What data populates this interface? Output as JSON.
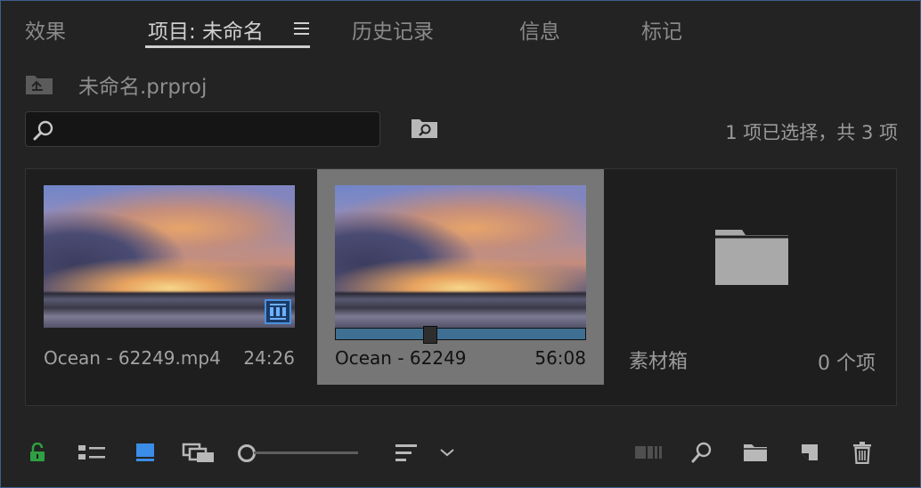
{
  "tabs": [
    {
      "label": "效果",
      "active": false
    },
    {
      "label": "项目: 未命名",
      "active": true
    },
    {
      "label": "历史记录",
      "active": false
    },
    {
      "label": "信息",
      "active": false
    },
    {
      "label": "标记",
      "active": false
    }
  ],
  "project": {
    "name": "未命名.prproj"
  },
  "search": {
    "placeholder": "",
    "value": ""
  },
  "selection_info": "1 项已选择，共 3 项",
  "items": [
    {
      "name": "Ocean - 62249.mp4",
      "duration": "24:26",
      "type": "clip",
      "selected": false,
      "badge": "film-icon"
    },
    {
      "name": "Ocean - 62249",
      "duration": "56:08",
      "type": "sequence",
      "selected": true,
      "scrub_position": 0.37
    },
    {
      "name": "素材箱",
      "count": "0 个项",
      "type": "bin",
      "selected": false
    }
  ],
  "colors": {
    "background": "#232323",
    "selected_tile": "#767676",
    "lock_icon": "#2ea043",
    "active_view_icon": "#3b8de8",
    "scrub_bar": "#3f6f92"
  },
  "toolbar": {
    "icons": [
      "lock-open-icon",
      "list-view-icon",
      "icon-view-icon",
      "freeform-view-icon",
      "zoom-slider",
      "sort-icon",
      "chevron-down-icon",
      "automate-to-sequence-icon",
      "find-icon",
      "new-bin-icon",
      "new-item-icon",
      "trash-icon"
    ],
    "zoom_level": 0.0
  }
}
